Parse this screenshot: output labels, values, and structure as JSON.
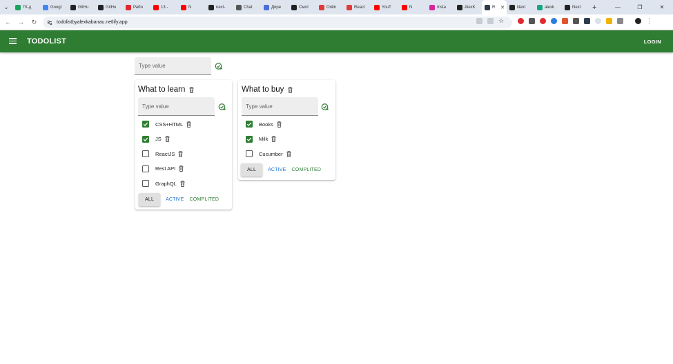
{
  "browser": {
    "tabs": [
      {
        "label": "ГК-д",
        "color": "#1aa260"
      },
      {
        "label": "Googl",
        "color": "#4285f4"
      },
      {
        "label": "GitHu",
        "color": "#222222"
      },
      {
        "label": "GitHu",
        "color": "#222222"
      },
      {
        "label": "Рабо",
        "color": "#e0282e"
      },
      {
        "label": "13 -",
        "color": "#ff0000"
      },
      {
        "label": "N",
        "color": "#ff0000"
      },
      {
        "label": "next-",
        "color": "#222222"
      },
      {
        "label": "Chat",
        "color": "#555555"
      },
      {
        "label": "Дире",
        "color": "#4a6fd6"
      },
      {
        "label": "Смот",
        "color": "#222222"
      },
      {
        "label": "Onlin",
        "color": "#e03a3a"
      },
      {
        "label": "React",
        "color": "#e03a3a"
      },
      {
        "label": "YouT",
        "color": "#ff0000"
      },
      {
        "label": "N",
        "color": "#ff0000"
      },
      {
        "label": "Insta",
        "color": "#d6249f"
      },
      {
        "label": "AlexK",
        "color": "#222222"
      }
    ],
    "active_tab": {
      "label": "R",
      "color": "#2e3a4e"
    },
    "tabs_after": [
      {
        "label": "Next",
        "color": "#222222"
      },
      {
        "label": "alexk",
        "color": "#17a589"
      },
      {
        "label": "Next",
        "color": "#222222"
      }
    ],
    "url": "todolistbyalexkabanau.netlify.app"
  },
  "appbar": {
    "title": "TODOLIST",
    "login_label": "LOGIN"
  },
  "top_input": {
    "placeholder": "Type value"
  },
  "todolists": [
    {
      "title": "What to learn",
      "placeholder": "Type value",
      "tasks": [
        {
          "label": "CSS+HTML",
          "done": true
        },
        {
          "label": "JS",
          "done": true
        },
        {
          "label": "ReactJS",
          "done": false
        },
        {
          "label": "Rest API",
          "done": false
        },
        {
          "label": "GraphQL",
          "done": false
        }
      ],
      "filters": {
        "all": "ALL",
        "active": "ACTIVE",
        "completed": "COMPLITED"
      }
    },
    {
      "title": "What to buy",
      "placeholder": "Type value",
      "tasks": [
        {
          "label": "Books",
          "done": true
        },
        {
          "label": "Milk",
          "done": true
        },
        {
          "label": "Cucumber",
          "done": false
        }
      ],
      "filters": {
        "all": "ALL",
        "active": "ACTIVE",
        "completed": "COMPLITED"
      }
    }
  ],
  "colors": {
    "primary": "#2e7d32",
    "active_filter": "#1976d2",
    "input_bg": "#eeeeee"
  }
}
